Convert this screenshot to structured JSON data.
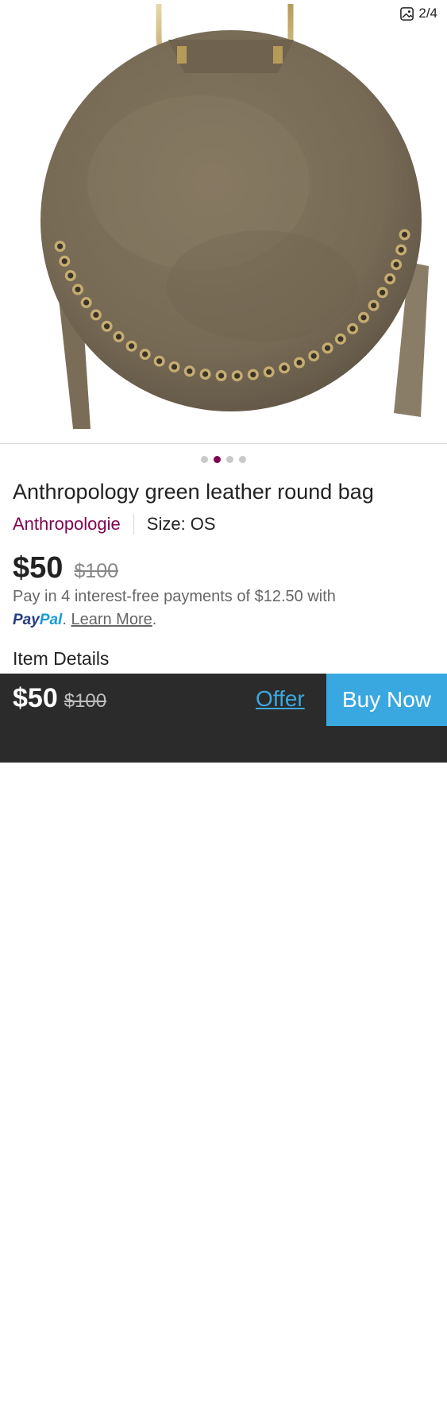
{
  "gallery": {
    "counter": "2/4",
    "total_dots": 4,
    "active_dot": 2,
    "accent_color": "#7f0353"
  },
  "listing": {
    "title": "Anthropology green leather round bag",
    "brand": "Anthropologie",
    "size": "Size: OS",
    "price": "$50",
    "original_price": "$100"
  },
  "paypal": {
    "text": "Pay in 4 interest-free payments of $12.50 with",
    "logo_pay": "Pay",
    "logo_pal": "Pal",
    "period": ".",
    "learn_more": "Learn More",
    "end": "."
  },
  "sections": {
    "item_details": "Item Details"
  },
  "bottom_bar": {
    "price": "$50",
    "original_price": "$100",
    "offer_label": "Offer",
    "buy_label": "Buy Now",
    "button_color": "#3aa8e0"
  }
}
